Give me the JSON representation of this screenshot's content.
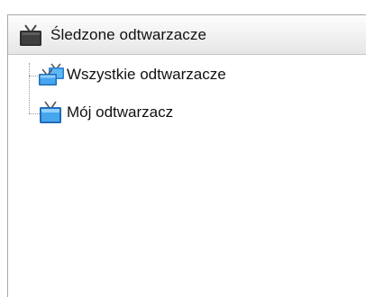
{
  "header": {
    "title": "Śledzone odtwarzacze",
    "icon": "tv-icon"
  },
  "tree": {
    "items": [
      {
        "label": "Wszystkie odtwarzacze",
        "icon": "tv-group-icon"
      },
      {
        "label": "Mój odtwarzacz",
        "icon": "tv-icon"
      }
    ]
  },
  "colors": {
    "screen_blue": "#3d9ee8",
    "header_tv": "#3a3a3a",
    "antenna": "#5a5a5a"
  }
}
